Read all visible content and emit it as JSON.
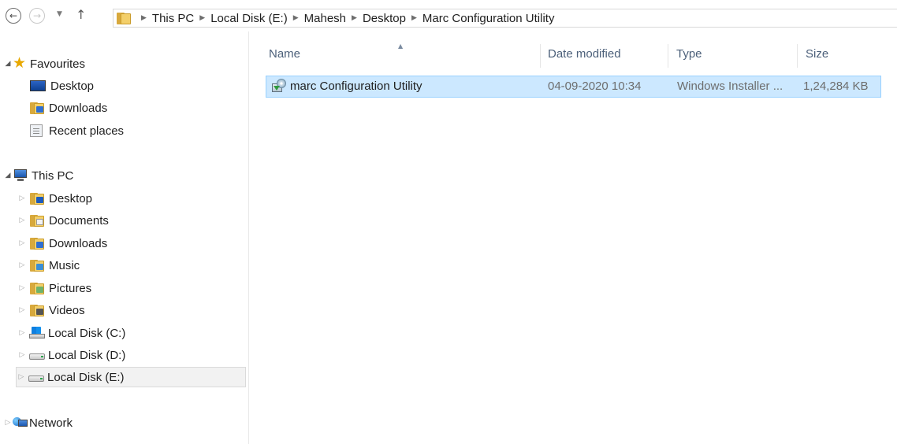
{
  "address_bar": {
    "back_icon": "back-arrow-icon",
    "forward_icon": "forward-arrow-icon",
    "recent_icon": "chevron-down-icon",
    "up_icon": "up-arrow-icon",
    "back_glyph": "←",
    "forward_glyph": "→",
    "recent_glyph": "▼",
    "up_glyph": "↑",
    "separator_glyph": "▶",
    "breadcrumbs": [
      "This PC",
      "Local Disk (E:)",
      "Mahesh",
      "Desktop",
      "Marc Configuration Utility"
    ]
  },
  "sidebar": {
    "expand_glyph": "◢",
    "collapse_glyph": "▷",
    "favourites": {
      "label": "Favourites",
      "items": [
        {
          "label": "Desktop",
          "icon": "desktop-icon"
        },
        {
          "label": "Downloads",
          "icon": "downloads-folder-icon"
        },
        {
          "label": "Recent places",
          "icon": "recent-places-icon"
        }
      ]
    },
    "this_pc": {
      "label": "This PC",
      "items": [
        {
          "label": "Desktop",
          "icon": "desktop-folder-icon"
        },
        {
          "label": "Documents",
          "icon": "documents-folder-icon"
        },
        {
          "label": "Downloads",
          "icon": "downloads-folder-icon"
        },
        {
          "label": "Music",
          "icon": "music-folder-icon"
        },
        {
          "label": "Pictures",
          "icon": "pictures-folder-icon"
        },
        {
          "label": "Videos",
          "icon": "videos-folder-icon"
        },
        {
          "label": "Local Disk (C:)",
          "icon": "system-drive-icon"
        },
        {
          "label": "Local Disk (D:)",
          "icon": "drive-icon"
        },
        {
          "label": "Local Disk (E:)",
          "icon": "drive-icon",
          "selected": true
        }
      ]
    },
    "network": {
      "label": "Network",
      "icon": "network-icon"
    }
  },
  "file_list": {
    "columns": {
      "name": "Name",
      "date_modified": "Date modified",
      "type": "Type",
      "size": "Size"
    },
    "sort_glyph": "▲",
    "rows": [
      {
        "name": "marc Configuration Utility",
        "date_modified": "04-09-2020 10:34",
        "type": "Windows Installer ...",
        "size": "1,24,284 KB",
        "icon": "windows-installer-icon",
        "selected": true
      }
    ]
  },
  "colors": {
    "selection_bg": "#cce8ff",
    "selection_border": "#99d1ff",
    "header_text": "#4c607a",
    "sidebar_selected_bg": "#f2f2f2"
  }
}
